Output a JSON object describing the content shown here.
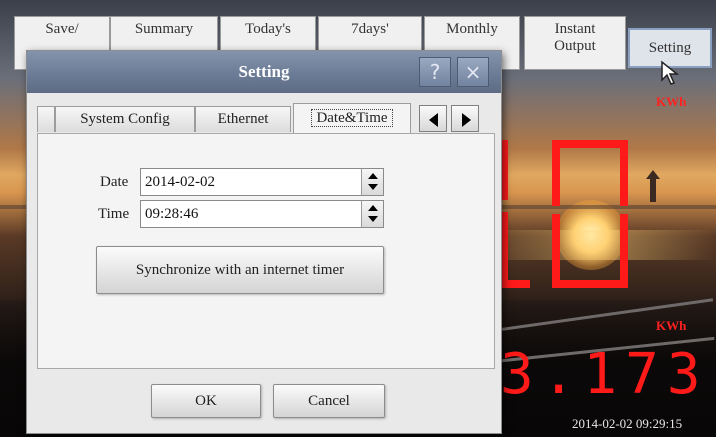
{
  "top_tabs": [
    {
      "label": "Save/"
    },
    {
      "label": "Summary"
    },
    {
      "label": "Today's"
    },
    {
      "label": "7days'"
    },
    {
      "label": "Monthly"
    },
    {
      "label": "Instant\nOutput"
    },
    {
      "label": "Setting"
    }
  ],
  "display": {
    "unit_top": "KWh",
    "unit_bottom": "KWh",
    "small_value": "3.173",
    "datetime": "2014-02-02 09:29:15"
  },
  "dialog": {
    "title": "Setting",
    "help_glyph": "?",
    "close_glyph": "×",
    "tabs": [
      "System Config",
      "Ethernet",
      "Date&Time"
    ],
    "active_tab": "Date&Time",
    "date_label": "Date",
    "date_value": "2014-02-02",
    "time_label": "Time",
    "time_value": "09:28:46",
    "sync_button": "Synchronize with an internet timer",
    "ok_button": "OK",
    "cancel_button": "Cancel"
  },
  "colors": {
    "titlebar": "#6d7c96",
    "display_red": "#ff1a1a"
  },
  "icons": [
    "help-icon",
    "close-icon",
    "arrow-left-icon",
    "arrow-right-icon",
    "spin-up-icon",
    "spin-down-icon",
    "mouse-cursor-icon"
  ]
}
